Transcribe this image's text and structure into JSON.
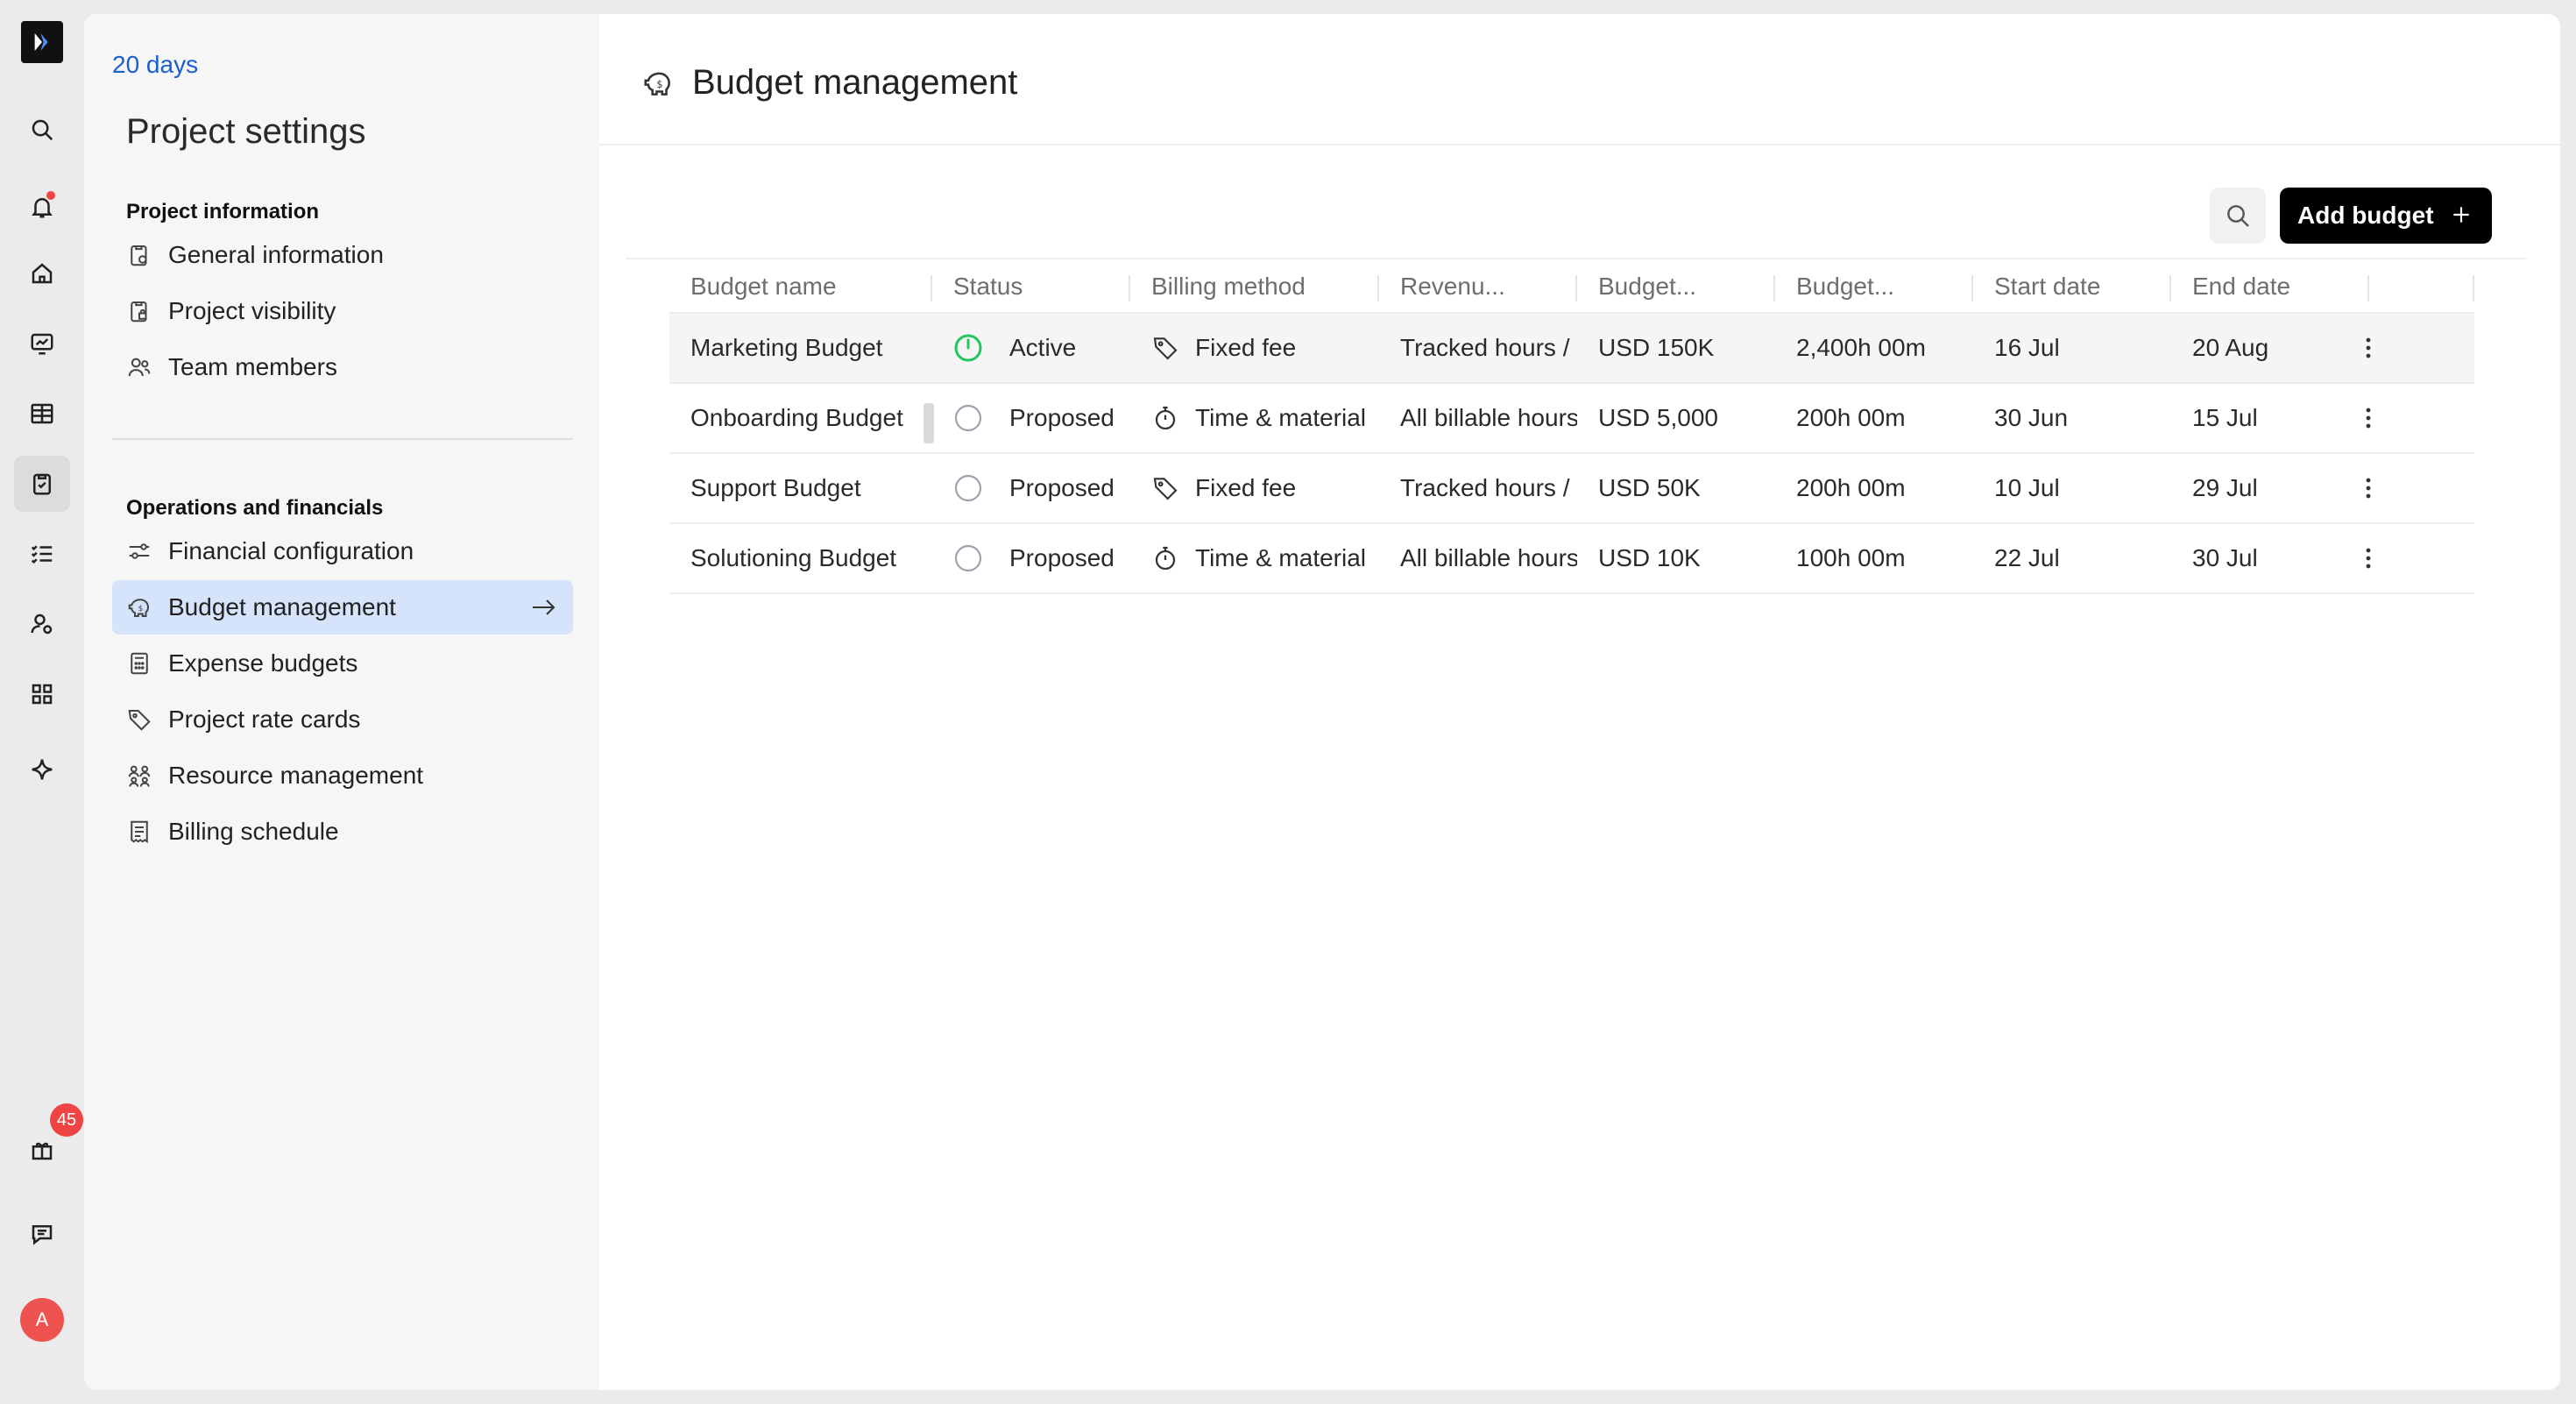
{
  "rail": {
    "icons": [
      "logo-icon",
      "search-icon",
      "bell-icon",
      "home-icon",
      "dashboard-icon",
      "table-icon",
      "clipboard-check-icon",
      "checklist-icon",
      "user-settings-icon",
      "apps-icon",
      "sparkle-icon",
      "gift-icon",
      "chat-icon"
    ],
    "gift_badge": "45",
    "avatar_initial": "A",
    "notification_dot_color": "#ef4444"
  },
  "settings": {
    "back_link": "20 days",
    "title": "Project settings",
    "sections": [
      {
        "label": "Project information",
        "items": [
          {
            "label": "General information",
            "icon": "clipboard-gear-icon"
          },
          {
            "label": "Project visibility",
            "icon": "clipboard-lock-icon"
          },
          {
            "label": "Team members",
            "icon": "users-icon"
          }
        ]
      },
      {
        "label": "Operations and financials",
        "items": [
          {
            "label": "Financial configuration",
            "icon": "sliders-icon"
          },
          {
            "label": "Budget management",
            "icon": "piggy-bank-icon",
            "selected": true
          },
          {
            "label": "Expense budgets",
            "icon": "calculator-icon"
          },
          {
            "label": "Project rate cards",
            "icon": "tag-icon"
          },
          {
            "label": "Resource management",
            "icon": "people-group-icon"
          },
          {
            "label": "Billing schedule",
            "icon": "receipt-icon"
          }
        ]
      }
    ],
    "selected_color": "#d6e4fb"
  },
  "main": {
    "title": "Budget management",
    "add_button": "Add budget",
    "columns": [
      "Budget name",
      "Status",
      "Billing method",
      "Revenu...",
      "Budget...",
      "Budget...",
      "Start date",
      "End date"
    ],
    "rows": [
      {
        "name": "Marketing Budget",
        "status": "Active",
        "billing": "Fixed fee",
        "revenue": "Tracked hours / rate",
        "budget_amount": "USD 150K",
        "budget_hours": "2,400h 00m",
        "start": "16 Jul",
        "end": "20 Aug"
      },
      {
        "name": "Onboarding Budget",
        "status": "Proposed",
        "billing": "Time & material",
        "revenue": "All billable hours",
        "budget_amount": "USD 5,000",
        "budget_hours": "200h 00m",
        "start": "30 Jun",
        "end": "15 Jul"
      },
      {
        "name": "Support Budget",
        "status": "Proposed",
        "billing": "Fixed fee",
        "revenue": "Tracked hours / rate",
        "budget_amount": "USD 50K",
        "budget_hours": "200h 00m",
        "start": "10 Jul",
        "end": "29 Jul"
      },
      {
        "name": "Solutioning Budget",
        "status": "Proposed",
        "billing": "Time & material",
        "revenue": "All billable hours",
        "budget_amount": "USD 10K",
        "budget_hours": "100h 00m",
        "start": "22 Jul",
        "end": "30 Jul"
      }
    ],
    "colors": {
      "active_status": "#22c55e",
      "proposed_status": "#9ca3af",
      "primary_button": "#000000"
    }
  }
}
